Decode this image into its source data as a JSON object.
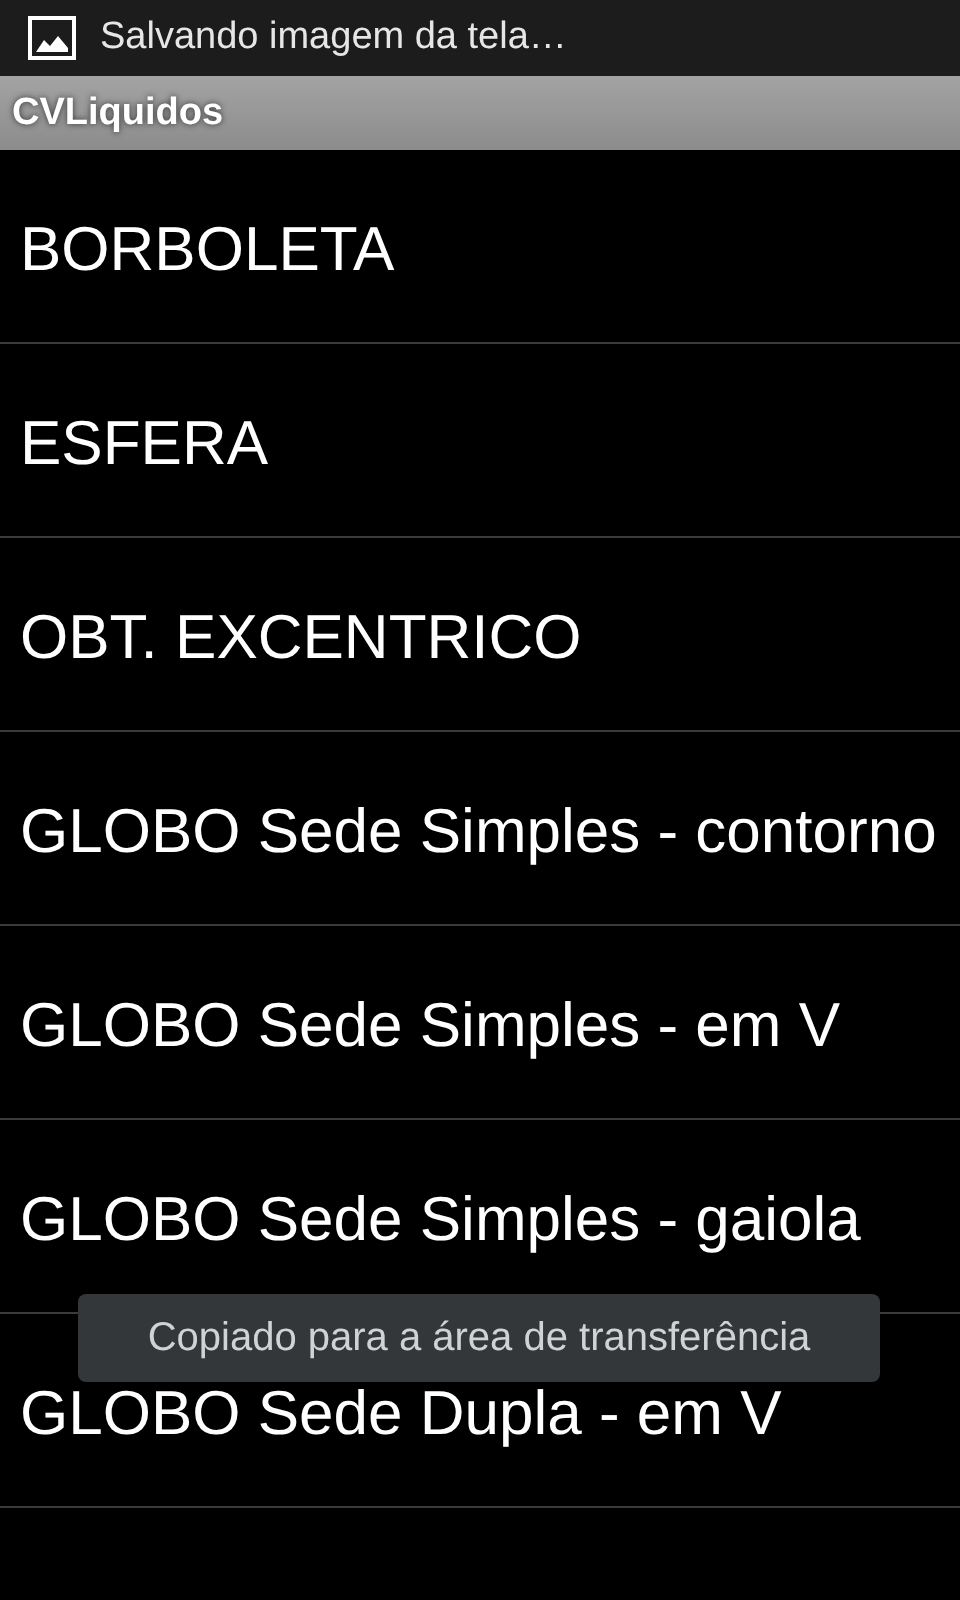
{
  "status_bar": {
    "notification": "Salvando imagem da tela…"
  },
  "title_bar": {
    "title": "CVLiquidos"
  },
  "list": {
    "items": [
      {
        "label": "BORBOLETA"
      },
      {
        "label": "ESFERA"
      },
      {
        "label": "OBT. EXCENTRICO"
      },
      {
        "label": "GLOBO Sede Simples - contorno"
      },
      {
        "label": "GLOBO Sede Simples - em V"
      },
      {
        "label": "GLOBO Sede Simples - gaiola"
      },
      {
        "label": "GLOBO Sede Dupla - em V"
      }
    ]
  },
  "toast": {
    "text": "Copiado para a área de transferência"
  }
}
